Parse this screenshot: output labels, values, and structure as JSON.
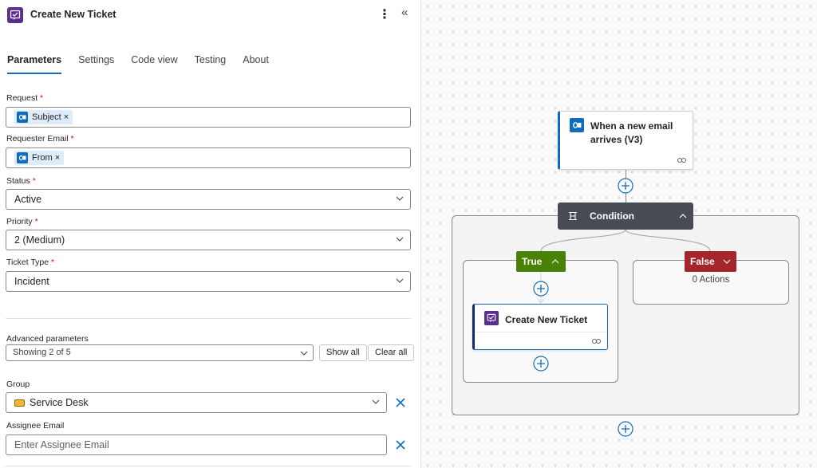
{
  "panel": {
    "title": "Create New Ticket",
    "more_icon": "more-vertical-icon",
    "collapse_icon": "chevron-double-left-icon",
    "tabs": [
      {
        "label": "Parameters",
        "active": true
      },
      {
        "label": "Settings",
        "active": false
      },
      {
        "label": "Code view",
        "active": false
      },
      {
        "label": "Testing",
        "active": false
      },
      {
        "label": "About",
        "active": false
      }
    ],
    "fields": {
      "request": {
        "label": "Request",
        "token": "Subject"
      },
      "requester_email": {
        "label": "Requester Email",
        "token": "From"
      },
      "status": {
        "label": "Status",
        "value": "Active"
      },
      "priority": {
        "label": "Priority",
        "value": "2 (Medium)"
      },
      "ticket_type": {
        "label": "Ticket Type",
        "value": "Incident"
      },
      "required_mark": "*",
      "token_remove": "×"
    },
    "advanced": {
      "label": "Advanced parameters",
      "value": "Showing 2 of 5",
      "show_all": "Show all",
      "clear_all": "Clear all"
    },
    "group": {
      "label": "Group",
      "value": "Service Desk",
      "badge_color": "#f2b632"
    },
    "assignee": {
      "label": "Assignee Email",
      "placeholder": "Enter Assignee Email"
    }
  },
  "canvas": {
    "trigger": {
      "title": "When a new email arrives (V3)"
    },
    "condition": {
      "title": "Condition",
      "color": "#484b54"
    },
    "true_branch": {
      "label": "True",
      "color": "#498205"
    },
    "false_branch": {
      "label": "False",
      "color": "#a4262c",
      "empty_text": "0 Actions"
    },
    "action": {
      "title": "Create New Ticket",
      "accent": "#5c2d91"
    }
  },
  "colors": {
    "accent": "#0f6cbd",
    "outlook": "#0f6cbd"
  }
}
